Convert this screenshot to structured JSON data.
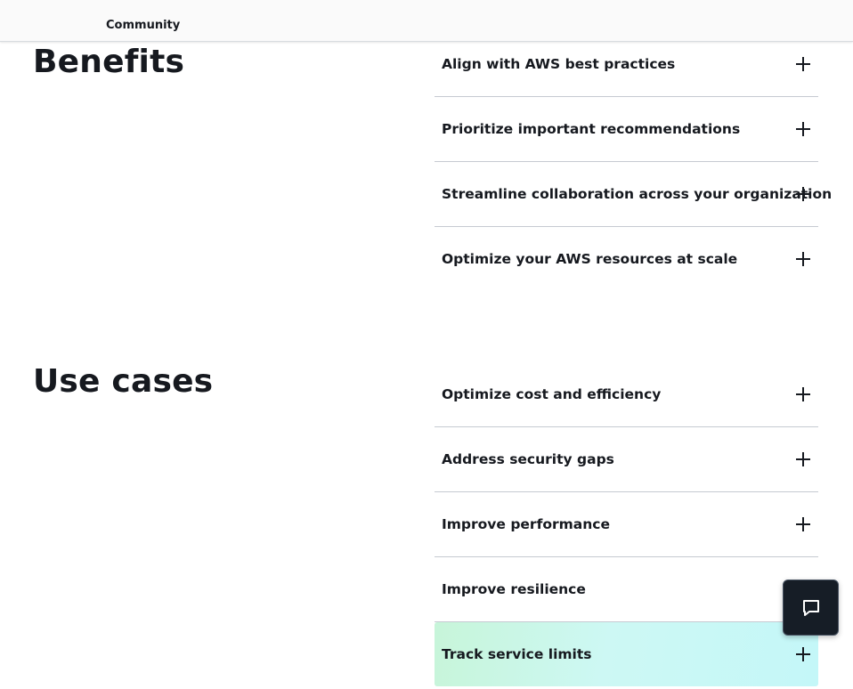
{
  "nav": {
    "community_label": "Community"
  },
  "benefits": {
    "title": "Benefits",
    "items": [
      {
        "label": "Align with AWS best practices",
        "icon": "plus-icon"
      },
      {
        "label": "Prioritize important recommendations",
        "icon": "plus-icon"
      },
      {
        "label": "Streamline collaboration across your organization",
        "icon": "plus-icon"
      },
      {
        "label": "Optimize your AWS resources at scale",
        "icon": "plus-icon"
      }
    ]
  },
  "use_cases": {
    "title": "Use cases",
    "items": [
      {
        "label": "Optimize cost and efficiency",
        "icon": "plus-icon"
      },
      {
        "label": "Address security gaps",
        "icon": "plus-icon"
      },
      {
        "label": "Improve performance",
        "icon": "plus-icon"
      },
      {
        "label": "Improve resilience",
        "icon": "plus-icon"
      },
      {
        "label": "Track service limits",
        "icon": "plus-icon",
        "highlighted": true
      }
    ]
  },
  "chat": {
    "icon": "chat-bubble-icon"
  },
  "colors": {
    "text": "#16191f",
    "divider": "#c6cad1",
    "highlight_start": "#c7f5d9",
    "highlight_end": "#c4f7f8",
    "chat_button_bg": "#161d26"
  }
}
